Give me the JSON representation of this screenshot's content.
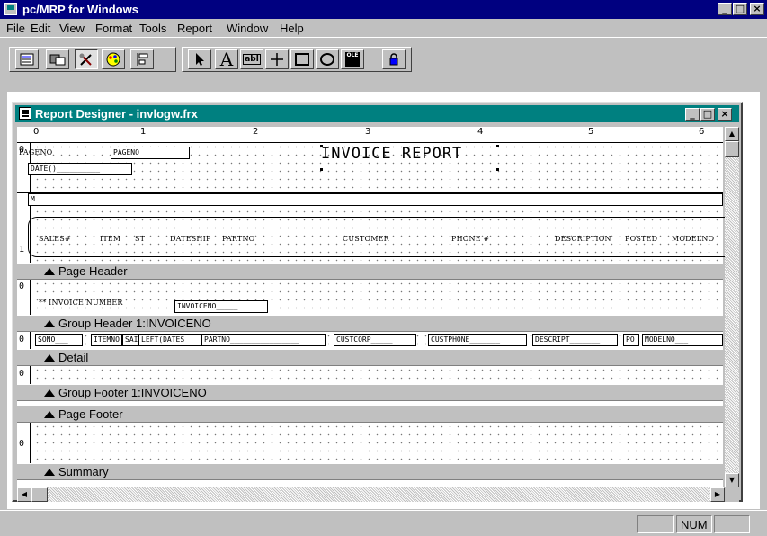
{
  "app": {
    "title": "pc/MRP for Windows",
    "controls": {
      "minimize": "_",
      "maximize": "□",
      "close": "×"
    }
  },
  "menu": [
    "File",
    "Edit",
    "View",
    "Format",
    "Tools",
    "Report",
    "Window",
    "Help"
  ],
  "toolbar": {
    "group1_icons": [
      "report-layout-icon",
      "data-environment-icon",
      "report-controls-icon",
      "color-palette-icon",
      "layout-icon"
    ],
    "group2_icons": [
      "select-pointer-icon",
      "label-icon",
      "field-icon",
      "line-icon",
      "rectangle-icon",
      "rounded-rectangle-icon",
      "ole-picture-icon",
      "button-lock-icon"
    ],
    "label_tool": "A",
    "field_tool": "abl",
    "ole_tool": "OLE"
  },
  "designer": {
    "title": "Report Designer - invlogw.frx",
    "ruler_numbers": [
      "0",
      "1",
      "2",
      "3",
      "4",
      "5",
      "6"
    ],
    "gutter_numbers": [
      "0",
      "1",
      "0",
      "0",
      "0",
      "0"
    ],
    "page_header": {
      "fields": [
        "PAGENO",
        "PAGENO_____",
        "DATE()__________",
        "M",
        "INVOICE REPORT"
      ],
      "columns": [
        "SALES#",
        "ITEM",
        "ST",
        "DATESHIP",
        "PARTNO",
        "CUSTOMER",
        "PHONE #",
        "DESCRIPTION",
        "POSTED",
        "MODELNO"
      ]
    },
    "group_header": {
      "label": "** INVOICE NUMBER",
      "field": "INVOICENO_____"
    },
    "detail_fields": [
      "SONO___",
      "ITEMNO",
      "SAI",
      "LEFT(DATES",
      "PARTNO________________",
      "CUSTCORP_____",
      "CUSTPHONE_______",
      "DESCRIPT_______",
      "PO",
      "MODELNO___"
    ],
    "bands": [
      "Page Header",
      "Group Header 1:INVOICENO",
      "Detail",
      "Group Footer 1:INVOICENO",
      "Page Footer",
      "Summary"
    ]
  },
  "status": {
    "mode": "NUM"
  }
}
